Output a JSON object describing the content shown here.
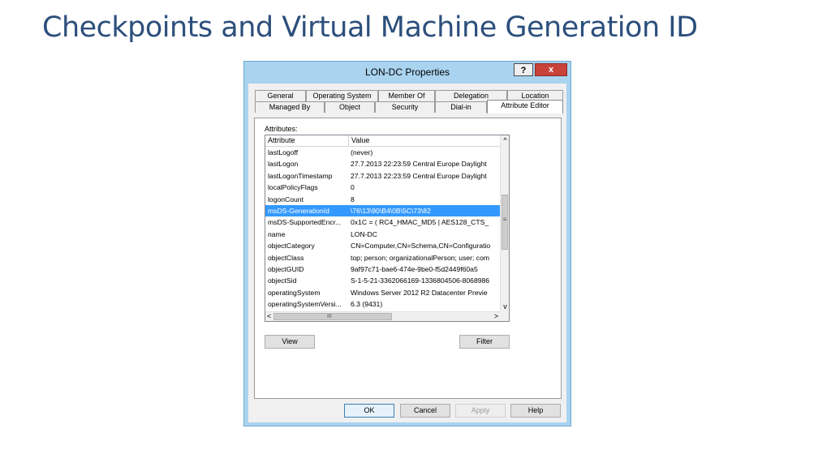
{
  "slide": {
    "title": "Checkpoints and Virtual Machine Generation ID"
  },
  "dialog": {
    "title": "LON-DC Properties",
    "help_label": "?",
    "close_label": "x",
    "tabs_row1": [
      "General",
      "Operating System",
      "Member Of",
      "Delegation",
      "Location"
    ],
    "tabs_row2": [
      "Managed By",
      "Object",
      "Security",
      "Dial-in",
      "Attribute Editor"
    ],
    "active_tab": "Attribute Editor",
    "attributes_label": "Attributes:",
    "columns": [
      "Attribute",
      "Value"
    ],
    "rows": [
      {
        "attribute": "lastLogoff",
        "value": "(never)"
      },
      {
        "attribute": "lastLogon",
        "value": "27.7.2013 22:23:59 Central Europe Daylight"
      },
      {
        "attribute": "lastLogonTimestamp",
        "value": "27.7.2013 22:23:59 Central Europe Daylight"
      },
      {
        "attribute": "localPolicyFlags",
        "value": "0"
      },
      {
        "attribute": "logonCount",
        "value": "8"
      },
      {
        "attribute": "msDS-GenerationId",
        "value": "\\76\\13\\90\\B4\\0B\\5C\\73\\82",
        "selected": true
      },
      {
        "attribute": "msDS-SupportedEncr...",
        "value": "0x1C = ( RC4_HMAC_MD5 | AES128_CTS_"
      },
      {
        "attribute": "name",
        "value": "LON-DC"
      },
      {
        "attribute": "objectCategory",
        "value": "CN=Computer,CN=Schema,CN=Configuratio"
      },
      {
        "attribute": "objectClass",
        "value": "top; person; organizationalPerson; user; com"
      },
      {
        "attribute": "objectGUID",
        "value": "9af97c71-bae6-474e-9be0-f5d2449f60a5"
      },
      {
        "attribute": "objectSid",
        "value": "S-1-5-21-3362066169-1336804506-8068986"
      },
      {
        "attribute": "operatingSystem",
        "value": "Windows Server 2012 R2 Datacenter Previe"
      },
      {
        "attribute": "operatingSystemVersi...",
        "value": "6.3 (9431)"
      }
    ],
    "scroll": {
      "up": "^",
      "down": "v",
      "left": "<",
      "right": ">",
      "grip_v": "≡",
      "grip_h": "III"
    },
    "view_button": "View",
    "filter_button": "Filter",
    "ok_button": "OK",
    "cancel_button": "Cancel",
    "apply_button": "Apply",
    "help_button": "Help"
  }
}
